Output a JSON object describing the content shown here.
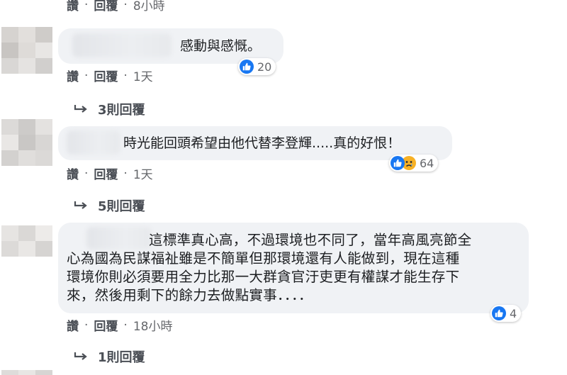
{
  "top_actions": {
    "like": "讚",
    "reply": "回覆",
    "time": "8小時"
  },
  "comments": [
    {
      "text": "感動與感慨。",
      "reaction_count": "20",
      "actions": {
        "like": "讚",
        "reply": "回覆",
        "time": "1天"
      },
      "replies": "3則回覆"
    },
    {
      "text": "時光能回頭希望由他代替李登輝.....真的好恨！",
      "reaction_count": "64",
      "actions": {
        "like": "讚",
        "reply": "回覆",
        "time": "1天"
      },
      "replies": "5則回覆"
    },
    {
      "text_lines": [
        "這標準真心高，不過環境也不同了，當年高風亮節全",
        "心為國為民謀福祉雖是不簡單但那環境還有人能做到，現在這種",
        "環境你則必須要用全力比那一大群貪官汙吏更有權謀才能生存下",
        "來，然後用剩下的餘力去做點實事．．．．"
      ],
      "reaction_count": "4",
      "actions": {
        "like": "讚",
        "reply": "回覆",
        "time": "18小時"
      },
      "replies": "1則回覆"
    }
  ],
  "colors": {
    "bubble": "#f0f2f5",
    "meta": "#65676b",
    "like": "#1877f2",
    "sad": "#f7b125"
  },
  "icons": [
    "like-reaction-icon",
    "sad-reaction-icon",
    "reply-arrow-icon"
  ]
}
